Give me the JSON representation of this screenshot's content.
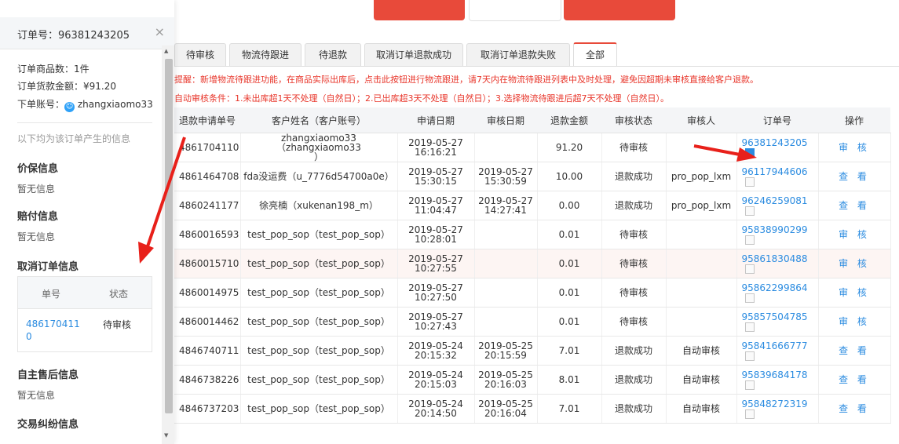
{
  "drawer": {
    "order_label": "订单号：96381243205",
    "close": "×",
    "goods_count": "订单商品数：1件",
    "amount": "订单货款金额：¥91.20",
    "account_prefix": "下单账号：",
    "account_name": "zhangxiaomo33",
    "info_hint": "以下均为该订单产生的信息",
    "sections": {
      "baojia_title": "价保信息",
      "baojia_empty": "暂无信息",
      "peifu_title": "赔付信息",
      "peifu_empty": "暂无信息",
      "cancel_title": "取消订单信息",
      "zizhu_title": "自主售后信息",
      "zizhu_empty": "暂无信息",
      "jiufen_title": "交易纠纷信息"
    },
    "cancel_table": {
      "col_no": "单号",
      "col_status": "状态",
      "row_no_1": "486170411",
      "row_no_2": "0",
      "row_status": "待审核"
    }
  },
  "tabs": [
    "待审核",
    "物流待跟进",
    "待退款",
    "取消订单退款成功",
    "取消订单退款失败",
    "全部"
  ],
  "active_tab": "全部",
  "notices": [
    "提醒：新增物流待跟进功能，在商品实际出库后，点击此按钮进行物流跟进，请7天内在物流待跟进列表中及时处理，避免因超期未审核直接给客户退款。",
    "自动审核条件：1.未出库超1天不处理（自然日）；2.已出库超3天不处理（自然日）；3.选择物流待跟进后超7天不处理（自然日）。"
  ],
  "table": {
    "headers": [
      "退款申请单号",
      "客户姓名（客户账号）",
      "申请日期",
      "审核日期",
      "退款金额",
      "审核状态",
      "审核人",
      "订单号",
      "操作"
    ],
    "rows": [
      {
        "id": "4861704110",
        "customer": "zhangxiaomo33（zhangxiaomo33",
        "customer2": "）",
        "apply_date": "2019-05-27",
        "apply_time": "16:16:21",
        "review_date": "",
        "review_time": "",
        "amount": "91.20",
        "status": "待审核",
        "reviewer": "",
        "order": "96381243205",
        "action": "审 核"
      },
      {
        "id": "4861464708",
        "customer": "fda没运费（u_7776d54700a0e）",
        "customer2": "",
        "apply_date": "2019-05-27",
        "apply_time": "15:30:15",
        "review_date": "2019-05-27",
        "review_time": "15:30:59",
        "amount": "10.00",
        "status": "退款成功",
        "reviewer": "pro_pop_lxm",
        "order": "96117944606",
        "action": "查 看"
      },
      {
        "id": "4860241177",
        "customer": "徐亮楠（xukenan198_m）",
        "customer2": "",
        "apply_date": "2019-05-27",
        "apply_time": "11:04:47",
        "review_date": "2019-05-27",
        "review_time": "14:27:41",
        "amount": "0.00",
        "status": "退款成功",
        "reviewer": "pro_pop_lxm",
        "order": "96246259081",
        "action": "查 看"
      },
      {
        "id": "4860016593",
        "customer": "test_pop_sop（test_pop_sop）",
        "customer2": "",
        "apply_date": "2019-05-27",
        "apply_time": "10:28:01",
        "review_date": "",
        "review_time": "",
        "amount": "0.01",
        "status": "待审核",
        "reviewer": "",
        "order": "95838990299",
        "action": "审 核"
      },
      {
        "id": "4860015710",
        "customer": "test_pop_sop（test_pop_sop）",
        "customer2": "",
        "apply_date": "2019-05-27",
        "apply_time": "10:27:55",
        "review_date": "",
        "review_time": "",
        "amount": "0.01",
        "status": "待审核",
        "reviewer": "",
        "order": "95861830488",
        "action": "审 核"
      },
      {
        "id": "4860014975",
        "customer": "test_pop_sop（test_pop_sop）",
        "customer2": "",
        "apply_date": "2019-05-27",
        "apply_time": "10:27:50",
        "review_date": "",
        "review_time": "",
        "amount": "0.01",
        "status": "待审核",
        "reviewer": "",
        "order": "95862299864",
        "action": "审 核"
      },
      {
        "id": "4860014462",
        "customer": "test_pop_sop（test_pop_sop）",
        "customer2": "",
        "apply_date": "2019-05-27",
        "apply_time": "10:27:43",
        "review_date": "",
        "review_time": "",
        "amount": "0.01",
        "status": "待审核",
        "reviewer": "",
        "order": "95857504785",
        "action": "审 核"
      },
      {
        "id": "4846740711",
        "customer": "test_pop_sop（test_pop_sop）",
        "customer2": "",
        "apply_date": "2019-05-24",
        "apply_time": "20:15:32",
        "review_date": "2019-05-25",
        "review_time": "20:15:59",
        "amount": "7.01",
        "status": "退款成功",
        "reviewer": "自动审核",
        "order": "95841666777",
        "action": "查 看"
      },
      {
        "id": "4846738226",
        "customer": "test_pop_sop（test_pop_sop）",
        "customer2": "",
        "apply_date": "2019-05-24",
        "apply_time": "20:15:03",
        "review_date": "2019-05-25",
        "review_time": "20:16:03",
        "amount": "8.01",
        "status": "退款成功",
        "reviewer": "自动审核",
        "order": "95839684178",
        "action": "查 看"
      },
      {
        "id": "4846737203",
        "customer": "test_pop_sop（test_pop_sop）",
        "customer2": "",
        "apply_date": "2019-05-24",
        "apply_time": "20:14:50",
        "review_date": "2019-05-25",
        "review_time": "20:16:04",
        "amount": "7.01",
        "status": "退款成功",
        "reviewer": "自动审核",
        "order": "95848272319",
        "action": "查 看"
      }
    ]
  },
  "colors": {
    "accent_red": "#e84a3a",
    "link_blue": "#2a8be0",
    "notice_red": "#e8352a"
  }
}
